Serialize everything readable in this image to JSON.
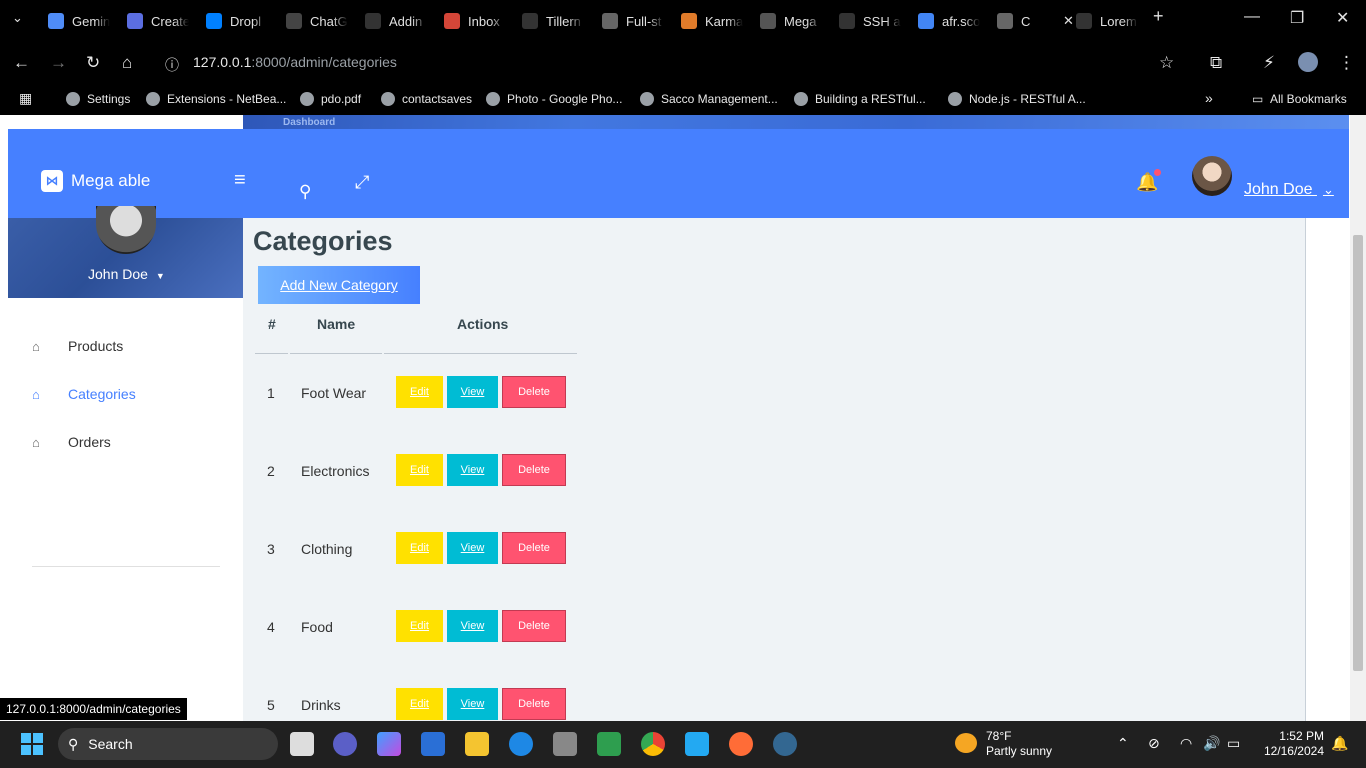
{
  "browser": {
    "tabs": [
      {
        "label": "Gemin",
        "icon": "gemini-icon",
        "color": "#4f8cf7"
      },
      {
        "label": "Create",
        "icon": "create-icon",
        "color": "#5b6ee1"
      },
      {
        "label": "Dropl",
        "icon": "digitalocean-icon",
        "color": "#0080ff"
      },
      {
        "label": "ChatG",
        "icon": "chatgpt-icon",
        "color": "#444"
      },
      {
        "label": "Addin",
        "icon": "github-icon",
        "color": "#333"
      },
      {
        "label": "Inbox",
        "icon": "gmail-icon",
        "color": "#d44638"
      },
      {
        "label": "Tillern",
        "icon": "github-icon",
        "color": "#333"
      },
      {
        "label": "Full-st",
        "icon": "globe-icon",
        "color": "#666"
      },
      {
        "label": "Karma",
        "icon": "karma-icon",
        "color": "#e07b2a"
      },
      {
        "label": "Mega",
        "icon": "mega-icon",
        "color": "#555"
      },
      {
        "label": "SSH a",
        "icon": "github-icon",
        "color": "#333"
      },
      {
        "label": "afr.sco",
        "icon": "google-icon",
        "color": "#4285f4"
      },
      {
        "label": "C",
        "icon": "globe-icon",
        "color": "#666"
      },
      {
        "label": "Lorem",
        "icon": "lorem-icon",
        "color": "#333"
      }
    ],
    "url_host": "127.0.0.1",
    "url_path": ":8000/admin/categories",
    "bookmarks": [
      {
        "label": "Settings"
      },
      {
        "label": "Extensions - NetBea..."
      },
      {
        "label": "pdo.pdf"
      },
      {
        "label": "contactsaves"
      },
      {
        "label": "Photo - Google Pho..."
      },
      {
        "label": "Sacco Management..."
      },
      {
        "label": "Building a RESTful..."
      },
      {
        "label": "Node.js - RESTful A..."
      }
    ],
    "all_bookmarks": "All Bookmarks",
    "status_url": "127.0.0.1:8000/admin/categories"
  },
  "app": {
    "brand": "Mega able",
    "breadcrumb": "Dashboard",
    "user_name": "John Doe",
    "sidebar_user": "John Doe",
    "accent": "#4680ff"
  },
  "sidebar": {
    "items": [
      {
        "label": "Products"
      },
      {
        "label": "Categories"
      },
      {
        "label": "Orders"
      }
    ]
  },
  "main": {
    "title": "Categories",
    "add_button": "Add New Category",
    "columns": [
      "#",
      "Name",
      "Actions"
    ],
    "rows": [
      {
        "id": "1",
        "name": "Foot Wear"
      },
      {
        "id": "2",
        "name": "Electronics"
      },
      {
        "id": "3",
        "name": "Clothing"
      },
      {
        "id": "4",
        "name": "Food"
      },
      {
        "id": "5",
        "name": "Drinks"
      }
    ],
    "edit_label": "Edit",
    "view_label": "View",
    "delete_label": "Delete"
  },
  "taskbar": {
    "search": "Search",
    "weather_temp": "78°F",
    "weather_desc": "Partly sunny",
    "time": "1:52 PM",
    "date": "12/16/2024"
  }
}
